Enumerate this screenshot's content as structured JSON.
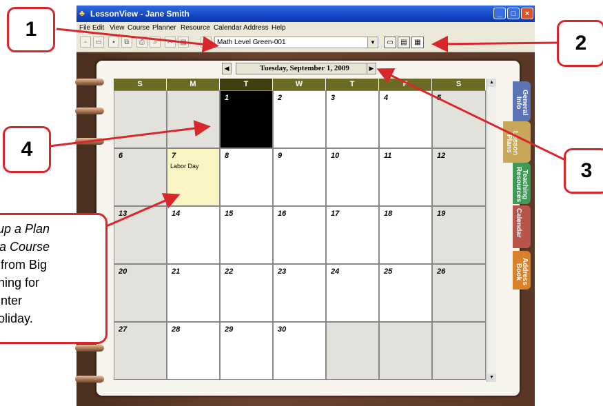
{
  "window": {
    "title": "LessonView - Jane Smith",
    "app_icon": "lessonview-app-icon",
    "controls": [
      "_",
      "□",
      "×"
    ]
  },
  "menu": [
    "File",
    "Edit",
    "View",
    "Course",
    "Planner",
    "Resource",
    "Calendar",
    "Address",
    "Help"
  ],
  "toolbar": {
    "course_selected": "Math Level Green-001",
    "view_buttons": [
      "day-view",
      "week-view",
      "month-view"
    ]
  },
  "calendar": {
    "date_label": "Tuesday, September 1, 2009",
    "weekday_headers": [
      "S",
      "M",
      "T",
      "W",
      "T",
      "F",
      "S"
    ],
    "weeks": [
      [
        "",
        "",
        "1",
        "2",
        "3",
        "4",
        "5"
      ],
      [
        "6",
        "7",
        "8",
        "9",
        "10",
        "11",
        "12"
      ],
      [
        "13",
        "14",
        "15",
        "16",
        "17",
        "18",
        "19"
      ],
      [
        "20",
        "21",
        "22",
        "23",
        "24",
        "25",
        "26"
      ],
      [
        "27",
        "28",
        "29",
        "30",
        "",
        "",
        ""
      ]
    ],
    "events": {
      "7": "Labor Day"
    },
    "selected_day": "1"
  },
  "tabs": [
    {
      "label": "General Info",
      "color": "#5b74b5"
    },
    {
      "label": "Lesson Plans",
      "color": "#c9a75a"
    },
    {
      "label": "Teaching Resources",
      "color": "#3f9a55"
    },
    {
      "label": "Calendar",
      "color": "#b9544a"
    },
    {
      "label": "Address Book",
      "color": "#d9822b"
    }
  ],
  "callouts": {
    "c1": "1",
    "c2": "2",
    "c3": "3",
    "c4": "4",
    "note_lines": [
      "tup a Plan",
      "a Course",
      "from Big",
      "hing for",
      "nter",
      "oliday."
    ]
  },
  "colors": {
    "accent_red": "#d9262b",
    "header_olive": "#6b6b24",
    "holiday_yellow": "#fbf5c4",
    "selected_black": "#000000"
  }
}
